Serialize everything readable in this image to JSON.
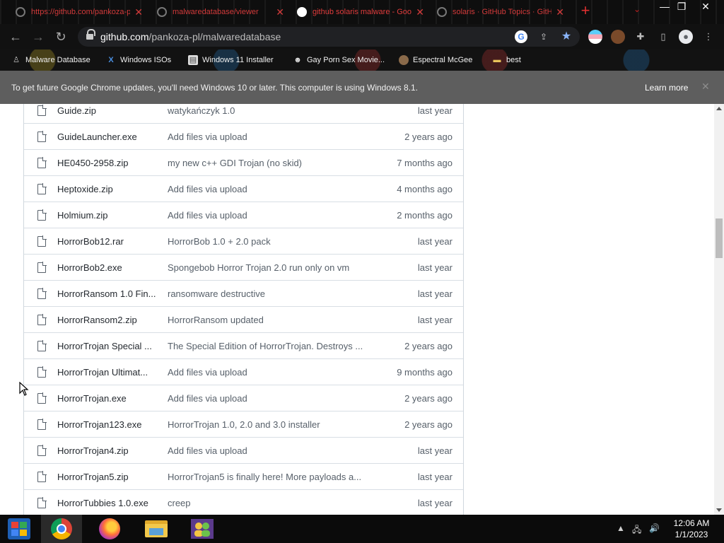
{
  "browser": {
    "tabs": [
      {
        "title": "https://github.com/pankoza-pl",
        "active": false
      },
      {
        "title": "malwaredatabase/viewer",
        "active": false
      },
      {
        "title": "github solaris malware - Google",
        "active": true
      },
      {
        "title": "solaris · GitHub Topics · GitHub",
        "active": false
      }
    ],
    "new_tab_label": "+",
    "tab_search_label": "⌄",
    "window_controls": {
      "minimize": "—",
      "restore": "❐",
      "close": "✕"
    },
    "nav": {
      "back": "←",
      "forward": "→",
      "reload": "↻"
    },
    "url": {
      "host": "github.com",
      "path": "/pankoza-pl/malwaredatabase"
    },
    "bookmarks": [
      {
        "label": "Malware Database",
        "icon": "figure-icon"
      },
      {
        "label": "Windows ISOs",
        "icon": "x-icon"
      },
      {
        "label": "Windows 11 Installer",
        "icon": "image-icon"
      },
      {
        "label": "Gay Porn Sex Movie...",
        "icon": "cat-icon"
      },
      {
        "label": "Espectral McGee",
        "icon": "avatar-icon"
      },
      {
        "label": "best",
        "icon": "folder-icon"
      }
    ]
  },
  "infobar": {
    "message": "To get future Google Chrome updates, you'll need Windows 10 or later. This computer is using Windows 8.1.",
    "learn_more": "Learn more",
    "close": "✕"
  },
  "files": [
    {
      "name": "Guide.zip",
      "message": "watykańczyk 1.0",
      "age": "last year"
    },
    {
      "name": "GuideLauncher.exe",
      "message": "Add files via upload",
      "age": "2 years ago"
    },
    {
      "name": "HE0450-2958.zip",
      "message": "my new c++ GDI Trojan (no skid)",
      "age": "7 months ago"
    },
    {
      "name": "Heptoxide.zip",
      "message": "Add files via upload",
      "age": "4 months ago"
    },
    {
      "name": "Holmium.zip",
      "message": "Add files via upload",
      "age": "2 months ago"
    },
    {
      "name": "HorrorBob12.rar",
      "message": "HorrorBob 1.0 + 2.0 pack",
      "age": "last year"
    },
    {
      "name": "HorrorBob2.exe",
      "message": "Spongebob Horror Trojan 2.0 run only on vm",
      "age": "last year"
    },
    {
      "name": "HorrorRansom 1.0 Fin...",
      "message": "ransomware destructive",
      "age": "last year"
    },
    {
      "name": "HorrorRansom2.zip",
      "message": "HorrorRansom updated",
      "age": "last year"
    },
    {
      "name": "HorrorTrojan Special ...",
      "message": "The Special Edition of HorrorTrojan. Destroys ...",
      "age": "2 years ago"
    },
    {
      "name": "HorrorTrojan Ultimat...",
      "message": "Add files via upload",
      "age": "9 months ago"
    },
    {
      "name": "HorrorTrojan.exe",
      "message": "Add files via upload",
      "age": "2 years ago"
    },
    {
      "name": "HorrorTrojan123.exe",
      "message": "HorrorTrojan 1.0, 2.0 and 3.0 installer",
      "age": "2 years ago"
    },
    {
      "name": "HorrorTrojan4.zip",
      "message": "Add files via upload",
      "age": "last year"
    },
    {
      "name": "HorrorTrojan5.zip",
      "message": "HorrorTrojan5 is finally here! More payloads a...",
      "age": "last year"
    },
    {
      "name": "HorrorTubbies 1.0.exe",
      "message": "creep",
      "age": "last year"
    }
  ],
  "taskbar": {
    "clock_time": "12:06 AM",
    "clock_date": "1/1/2023"
  }
}
